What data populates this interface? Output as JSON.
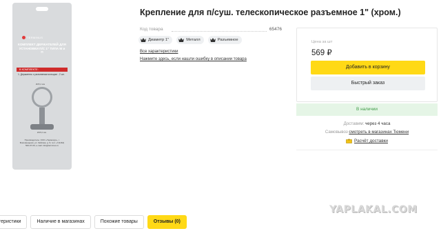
{
  "product": {
    "title": "Крепление для п/суш. телескопическое разъемное 1\" (хром.)",
    "code_label": "Код товара",
    "code_value": "65476",
    "tags": [
      {
        "label": "Диаметр 1\"",
        "icon": "crown-icon"
      },
      {
        "label": "Металл",
        "icon": "crown-icon"
      },
      {
        "label": "Разъемное",
        "icon": "crown-icon"
      }
    ],
    "all_specs_link": "Все характеристики",
    "report_error_link": "Нажмите здесь, если нашли ошибку в описании товара"
  },
  "package": {
    "brand": "TERMINUS",
    "title": "КОМПЛЕКТ ДЕРЖАТЕЛЕЙ ДЛЯ УСТАНОВКИ П/С 1\" ТИПА М и П",
    "in_set_label": "В КОМПЛЕКТЕ:",
    "in_set_note": "1. Держатель с разъемным кольцом - 2 шт.",
    "dim_top": "Ø25,4 мм",
    "dim_bottom": "Ø45,0 мм",
    "maker_text": "Производитель: ООО «Терминус», г. Благовещенск, ул. Зейская, д. 9; тел: +7(4162) 500-07-00, e-mail: info@terminus.ru"
  },
  "purchase": {
    "price_label": "Цена за шт",
    "price": "569 ₽",
    "add_to_cart": "Добавить в корзину",
    "quick_order": "Быстрый заказ",
    "stock_status": "В наличии",
    "delivery_label": "Доставим:",
    "delivery_value": "через 4 часа",
    "pickup_label": "Самовывоз",
    "pickup_link": "смотреть в магазинах Тюмени",
    "calc_delivery": "Расчёт доставки",
    "accent_color": "#ffd916",
    "stock_color": "#3f9b47"
  },
  "tabs": [
    {
      "label": "актеристики",
      "active": false
    },
    {
      "label": "Наличие в магазинах",
      "active": false
    },
    {
      "label": "Похожие товары",
      "active": false
    },
    {
      "label": "Отзывы (0)",
      "active": true
    }
  ],
  "watermark": "YAPLAKAL.COM"
}
